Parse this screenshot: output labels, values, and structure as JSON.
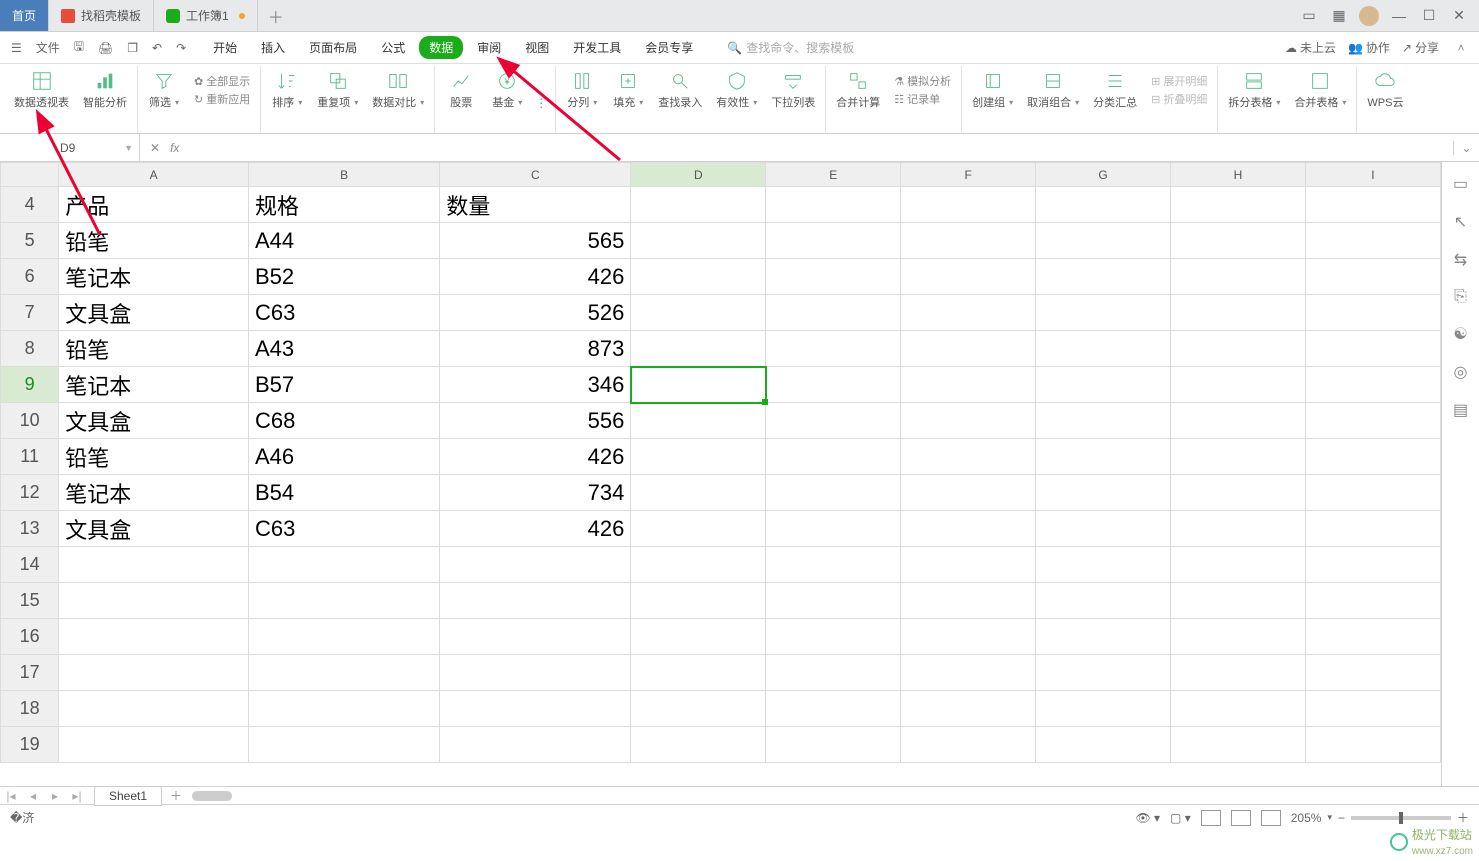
{
  "tabs": {
    "home": "首页",
    "docs": "找稻壳模板",
    "workbook": "工作簿1"
  },
  "menubar": {
    "file": "文件",
    "items": [
      "开始",
      "插入",
      "页面布局",
      "公式",
      "数据",
      "审阅",
      "视图",
      "开发工具",
      "会员专享"
    ],
    "active_index": 4,
    "search_placeholder": "查找命令、搜索模板",
    "cloud": "未上云",
    "collab": "协作",
    "share": "分享"
  },
  "ribbon": {
    "pivot": "数据透视表",
    "smart": "智能分析",
    "filter": "筛选",
    "showall": "全部显示",
    "reapply": "重新应用",
    "sort": "排序",
    "dup": "重复项",
    "compare": "数据对比",
    "stock": "股票",
    "fund": "基金",
    "cols": "分列",
    "fill": "填充",
    "lookup": "查找录入",
    "validate": "有效性",
    "dropdown": "下拉列表",
    "consolidate": "合并计算",
    "sim": "模拟分析",
    "record": "记录单",
    "group": "创建组",
    "ungroup": "取消组合",
    "subtotal": "分类汇总",
    "expand": "展开明细",
    "collapse": "折叠明细",
    "split": "拆分表格",
    "merge": "合并表格",
    "wps": "WPS云"
  },
  "fbar": {
    "cell": "D9",
    "fx": "fx"
  },
  "columns": [
    "A",
    "B",
    "C",
    "D",
    "E",
    "F",
    "G",
    "H",
    "I"
  ],
  "selected_col_index": 3,
  "rows": [
    {
      "n": 4,
      "a": "产品",
      "b": "规格",
      "c": "数量"
    },
    {
      "n": 5,
      "a": "铅笔",
      "b": "A44",
      "c": "565"
    },
    {
      "n": 6,
      "a": "笔记本",
      "b": "B52",
      "c": "426"
    },
    {
      "n": 7,
      "a": "文具盒",
      "b": "C63",
      "c": "526"
    },
    {
      "n": 8,
      "a": "铅笔",
      "b": "A43",
      "c": "873"
    },
    {
      "n": 9,
      "a": "笔记本",
      "b": "B57",
      "c": "346"
    },
    {
      "n": 10,
      "a": "文具盒",
      "b": "C68",
      "c": "556"
    },
    {
      "n": 11,
      "a": "铅笔",
      "b": "A46",
      "c": "426"
    },
    {
      "n": 12,
      "a": "笔记本",
      "b": "B54",
      "c": "734"
    },
    {
      "n": 13,
      "a": "文具盒",
      "b": "C63",
      "c": "426"
    },
    {
      "n": 14
    },
    {
      "n": 15
    },
    {
      "n": 16
    },
    {
      "n": 17
    },
    {
      "n": 18
    },
    {
      "n": 19
    }
  ],
  "selected_row": 9,
  "sheet_tab": "Sheet1",
  "status": {
    "zoom": "205%"
  },
  "watermark": {
    "brand": "极光下载站",
    "url": "www.xz7.com"
  }
}
